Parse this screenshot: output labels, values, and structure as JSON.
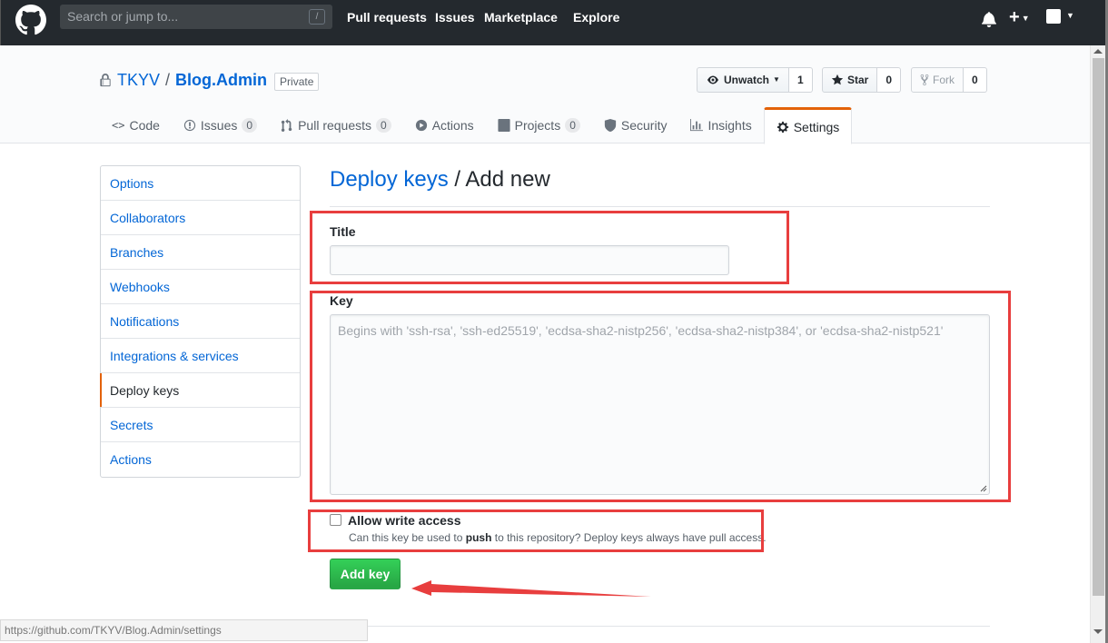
{
  "header": {
    "search_placeholder": "Search or jump to...",
    "search_key": "/",
    "nav": [
      "Pull requests",
      "Issues",
      "Marketplace",
      "Explore"
    ]
  },
  "repo": {
    "owner": "TKYV",
    "separator": "/",
    "name": "Blog.Admin",
    "visibility": "Private",
    "unwatch_label": "Unwatch",
    "watch_count": "1",
    "star_label": "Star",
    "star_count": "0",
    "fork_label": "Fork",
    "fork_count": "0"
  },
  "tabs": [
    {
      "label": "Code"
    },
    {
      "label": "Issues",
      "count": "0"
    },
    {
      "label": "Pull requests",
      "count": "0"
    },
    {
      "label": "Actions"
    },
    {
      "label": "Projects",
      "count": "0"
    },
    {
      "label": "Security"
    },
    {
      "label": "Insights"
    },
    {
      "label": "Settings"
    }
  ],
  "menu": [
    "Options",
    "Collaborators",
    "Branches",
    "Webhooks",
    "Notifications",
    "Integrations & services",
    "Deploy keys",
    "Secrets",
    "Actions"
  ],
  "form": {
    "heading_link": "Deploy keys",
    "heading_rest": "/ Add new",
    "title_label": "Title",
    "title_value": "",
    "key_label": "Key",
    "key_placeholder": "Begins with 'ssh-rsa', 'ssh-ed25519', 'ecdsa-sha2-nistp256', 'ecdsa-sha2-nistp384', or 'ecdsa-sha2-nistp521'",
    "write_access_label": "Allow write access",
    "write_access_checked": false,
    "note_before": "Can this key be used to ",
    "note_bold": "push",
    "note_after": " to this repository? Deploy keys always have pull access.",
    "submit_label": "Add key"
  },
  "status_bar": "https://github.com/TKYV/Blog.Admin/settings",
  "colors": {
    "header_bg": "#24292e",
    "link": "#0366d6",
    "accent_tab": "#e36209",
    "primary_button": "#28a745",
    "annotation_red": "#e83e3e"
  }
}
